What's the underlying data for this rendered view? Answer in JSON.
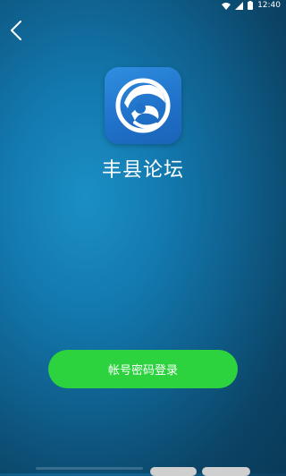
{
  "status_bar": {
    "time": "12:40"
  },
  "app": {
    "name": "丰县论坛"
  },
  "login": {
    "label": "帐号密码登录"
  },
  "colors": {
    "accent": "#2cd33f",
    "logo_bg": "#1f70c8"
  },
  "icons": [
    "back-chevron-icon",
    "wifi-icon",
    "signal-icon",
    "battery-icon",
    "phoenix-logo-icon"
  ]
}
